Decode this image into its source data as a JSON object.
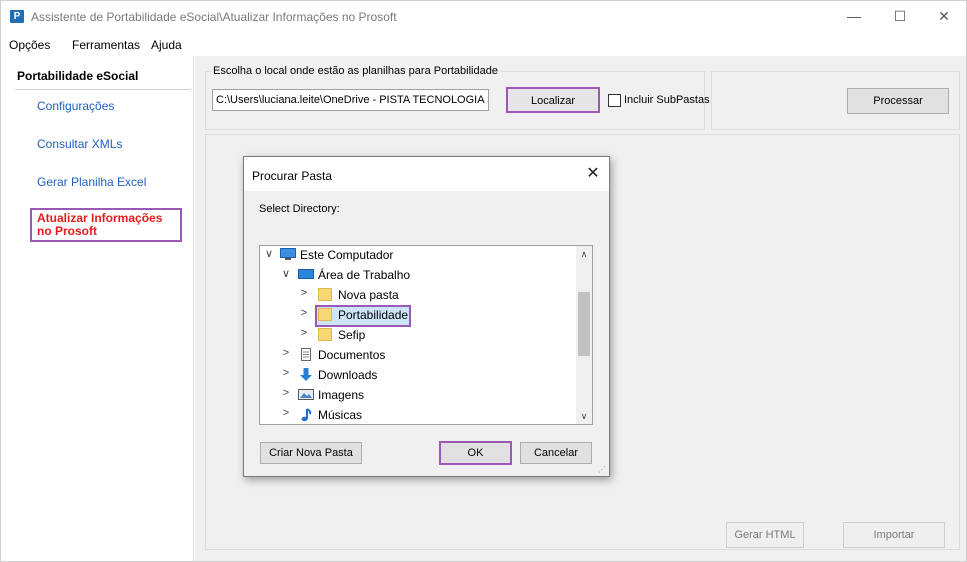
{
  "window": {
    "title": "Assistente de Portabilidade eSocial\\Atualizar Informações no Prosoft",
    "app_icon": "P",
    "minimize": "—",
    "maximize": "☐",
    "close": "✕"
  },
  "menu": {
    "items": [
      "Opções",
      "Ferramentas",
      "Ajuda"
    ]
  },
  "sidebar": {
    "header": "Portabilidade eSocial",
    "items": [
      {
        "label": "Configurações"
      },
      {
        "label": "Consultar XMLs"
      },
      {
        "label": "Gerar Planilha Excel"
      },
      {
        "label": "Atualizar Informações no Prosoft"
      }
    ]
  },
  "main": {
    "group_label": "Escolha o local onde estão as planilhas para Portabilidade",
    "path_value": "C:\\Users\\luciana.leite\\OneDrive - PISTA TECNOLOGIA S.",
    "localizar_label": "Localizar",
    "include_subfolders_label": "Incluir SubPastas",
    "include_subfolders_checked": false,
    "processar_label": "Processar",
    "gerar_html_label": "Gerar HTML",
    "importar_label": "Importar"
  },
  "dialog": {
    "title": "Procurar Pasta",
    "close": "✕",
    "prompt": "Select Directory:",
    "tree": [
      {
        "label": "Este Computador",
        "icon": "computer-icon",
        "arrow": "∨"
      },
      {
        "label": "Área de Trabalho",
        "icon": "desktop-icon",
        "arrow": "∨"
      },
      {
        "label": "Nova pasta",
        "icon": "folder-icon",
        "arrow": ">"
      },
      {
        "label": "Portabilidade",
        "icon": "folder-icon",
        "arrow": ">",
        "selected": true
      },
      {
        "label": "Sefip",
        "icon": "folder-icon",
        "arrow": ">"
      },
      {
        "label": "Documentos",
        "icon": "documents-icon",
        "arrow": ">"
      },
      {
        "label": "Downloads",
        "icon": "download-icon",
        "arrow": ">"
      },
      {
        "label": "Imagens",
        "icon": "images-icon",
        "arrow": ">"
      },
      {
        "label": "Músicas",
        "icon": "music-icon",
        "arrow": ">"
      }
    ],
    "scroll_up": "∧",
    "scroll_down": "∨",
    "new_folder_label": "Criar Nova Pasta",
    "ok_label": "OK",
    "cancel_label": "Cancelar"
  },
  "colors": {
    "accent_highlight": "#9b59b6",
    "active_link": "#e31b1b",
    "link": "#1f5fbf",
    "selection": "#cce4f7"
  }
}
